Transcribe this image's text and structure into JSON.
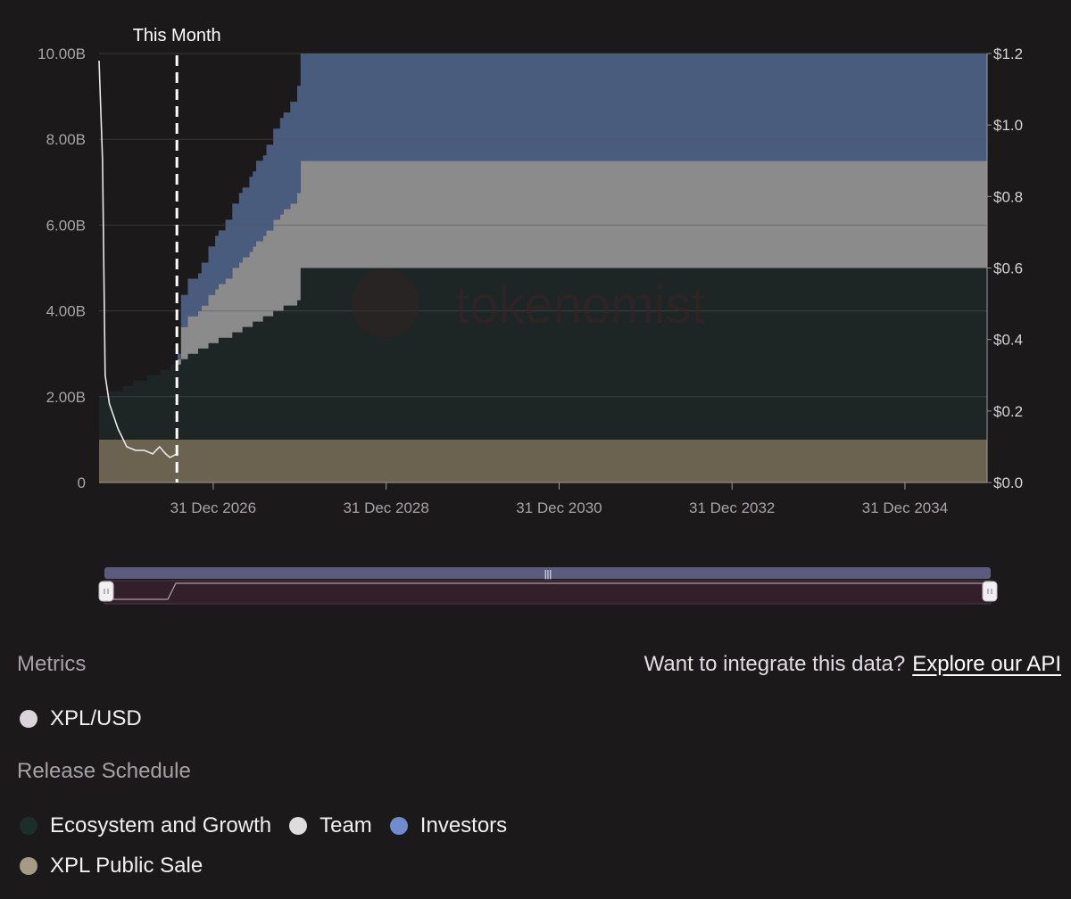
{
  "chart_data": {
    "type": "area",
    "title": "",
    "marker_label": "This Month",
    "left_axis": {
      "ticks": [
        "0",
        "2.00B",
        "4.00B",
        "6.00B",
        "8.00B",
        "10.00B"
      ],
      "ylim": [
        0,
        10000000000
      ]
    },
    "right_axis": {
      "ticks": [
        "$0.0",
        "$0.2",
        "$0.4",
        "$0.6",
        "$0.8",
        "$1.0",
        "$1.2"
      ],
      "ylim": [
        0,
        1.2
      ]
    },
    "x_ticks": [
      "31 Dec 2026",
      "31 Dec 2028",
      "31 Dec 2030",
      "31 Dec 2032",
      "31 Dec 2034"
    ],
    "x_tick_years": [
      2027.0,
      2029.0,
      2031.0,
      2033.0,
      2035.0
    ],
    "xlim": [
      2025.68,
      2035.95
    ],
    "this_month": 2026.58,
    "stacked_series": [
      {
        "name": "XPL Public Sale",
        "color": "#6b6250",
        "points": [
          [
            2025.68,
            1000000000
          ],
          [
            2035.95,
            1000000000
          ]
        ]
      },
      {
        "name": "Ecosystem and Growth",
        "color": "#1d2624",
        "step": true,
        "points": [
          [
            2025.68,
            1000000000
          ],
          [
            2026.0,
            1250000000
          ],
          [
            2026.58,
            1750000000
          ],
          [
            2026.63,
            1900000000
          ],
          [
            2027.0,
            2250000000
          ],
          [
            2028.0,
            3250000000
          ],
          [
            2028.0,
            4000000000
          ],
          [
            2035.95,
            4000000000
          ]
        ]
      },
      {
        "name": "Team",
        "color": "#8c8b8c",
        "step": true,
        "points": [
          [
            2025.68,
            0
          ],
          [
            2026.58,
            0
          ],
          [
            2026.63,
            750000000
          ],
          [
            2026.8,
            900000000
          ],
          [
            2028.0,
            2500000000
          ],
          [
            2035.95,
            2500000000
          ]
        ]
      },
      {
        "name": "Investors",
        "color": "#4a5c7e",
        "step": true,
        "points": [
          [
            2025.68,
            0
          ],
          [
            2026.58,
            0
          ],
          [
            2026.63,
            750000000
          ],
          [
            2026.8,
            900000000
          ],
          [
            2028.0,
            2500000000
          ],
          [
            2035.95,
            2500000000
          ]
        ]
      }
    ],
    "price_series": {
      "name": "XPL/USD",
      "color": "#e8e6e8",
      "points": [
        [
          2025.68,
          1.18
        ],
        [
          2025.72,
          0.9
        ],
        [
          2025.75,
          0.3
        ],
        [
          2025.8,
          0.22
        ],
        [
          2025.9,
          0.15
        ],
        [
          2026.0,
          0.1
        ],
        [
          2026.1,
          0.09
        ],
        [
          2026.2,
          0.09
        ],
        [
          2026.3,
          0.08
        ],
        [
          2026.38,
          0.1
        ],
        [
          2026.45,
          0.08
        ],
        [
          2026.5,
          0.07
        ],
        [
          2026.58,
          0.08
        ]
      ]
    },
    "navigator": {
      "range": [
        0,
        1
      ]
    },
    "watermark": "tokenomist"
  },
  "legend": {
    "metrics_title": "Metrics",
    "metrics": [
      {
        "label": "XPL/USD",
        "color": "#d9d5d8"
      }
    ],
    "release_title": "Release Schedule",
    "release": [
      {
        "label": "Ecosystem and Growth",
        "color": "#1c2e29"
      },
      {
        "label": "Team",
        "color": "#dddddd"
      },
      {
        "label": "Investors",
        "color": "#6f8ccc"
      },
      {
        "label": "XPL Public Sale",
        "color": "#a59a84"
      }
    ]
  },
  "api": {
    "prompt": "Want to integrate this data?",
    "link": "Explore our API"
  }
}
